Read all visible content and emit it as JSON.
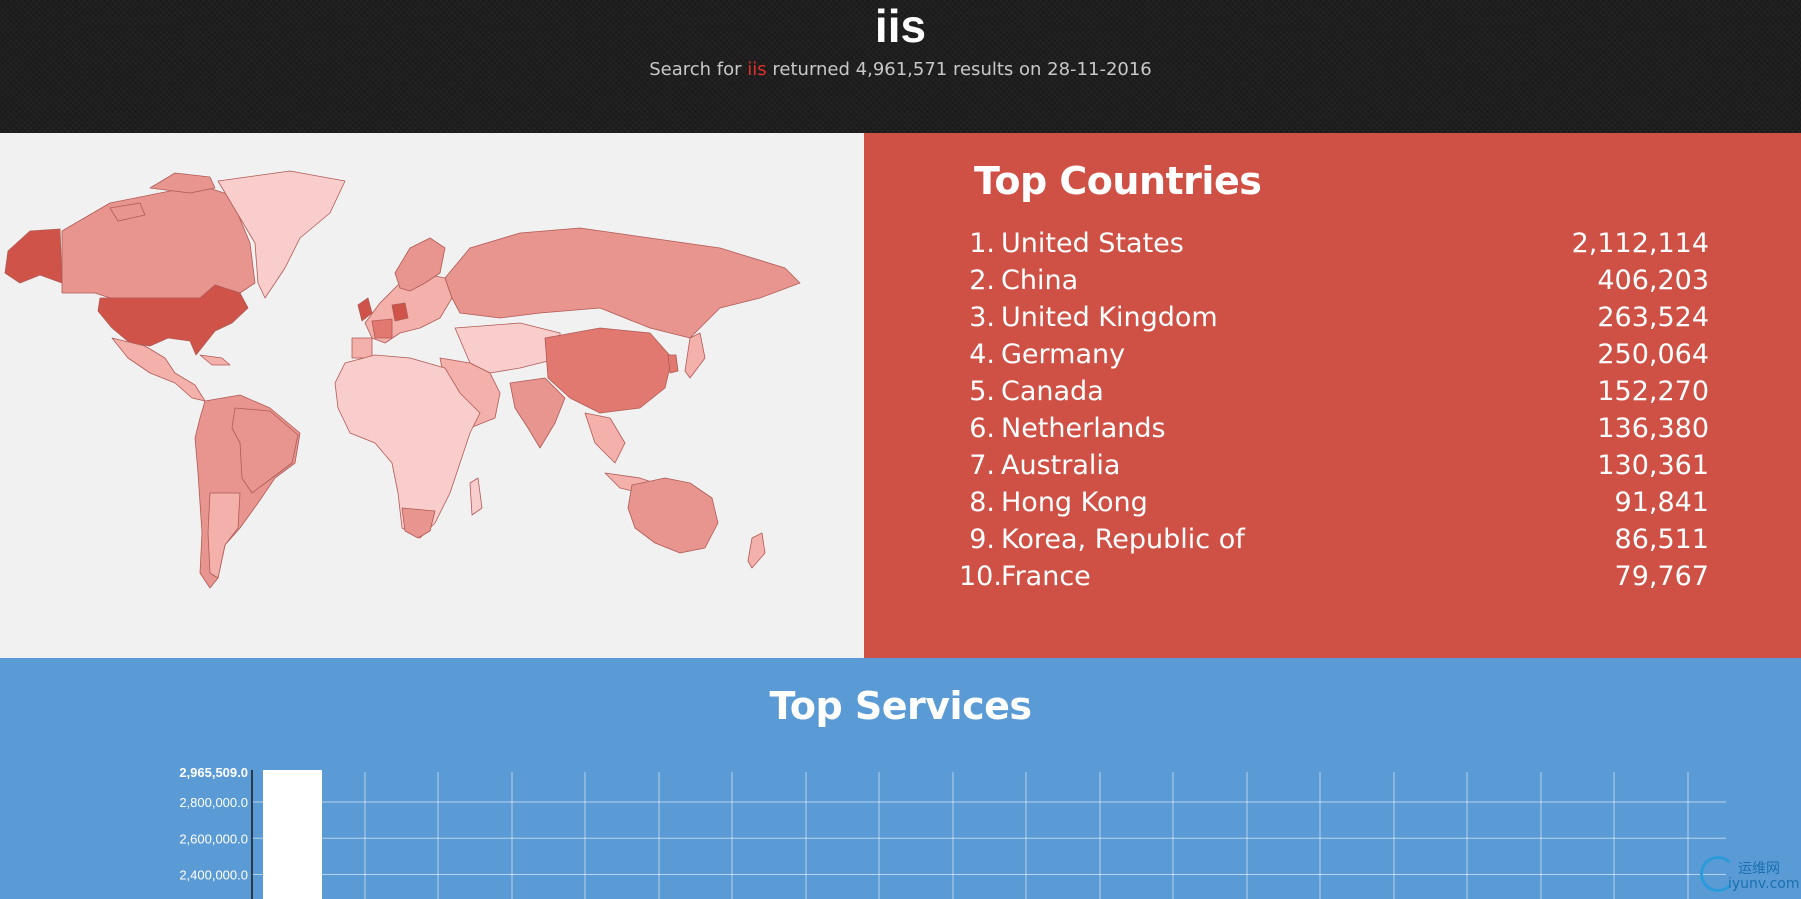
{
  "header": {
    "title": "iis",
    "subtitle_prefix": "Search for ",
    "query": "iis",
    "subtitle_suffix": " returned 4,961,571 results on 28-11-2016"
  },
  "colors": {
    "header_bg": "#1e1e1e",
    "map_bg": "#f1f1f1",
    "countries_bg": "#cf5146",
    "services_bg": "#5b9bd5",
    "query_highlight": "#e0302a"
  },
  "top_countries": {
    "title": "Top Countries",
    "items": [
      {
        "rank": "1.",
        "name": "United States",
        "count": "2,112,114"
      },
      {
        "rank": "2.",
        "name": "China",
        "count": "406,203"
      },
      {
        "rank": "3.",
        "name": "United Kingdom",
        "count": "263,524"
      },
      {
        "rank": "4.",
        "name": "Germany",
        "count": "250,064"
      },
      {
        "rank": "5.",
        "name": "Canada",
        "count": "152,270"
      },
      {
        "rank": "6.",
        "name": "Netherlands",
        "count": "136,380"
      },
      {
        "rank": "7.",
        "name": "Australia",
        "count": "130,361"
      },
      {
        "rank": "8.",
        "name": "Hong Kong",
        "count": "91,841"
      },
      {
        "rank": "9.",
        "name": "Korea, Republic of",
        "count": "86,511"
      },
      {
        "rank": "10.",
        "name": "France",
        "count": "79,767"
      }
    ]
  },
  "top_services": {
    "title": "Top Services"
  },
  "chart_data": {
    "type": "bar",
    "title": "Top Services",
    "ytick_labels": [
      "2,965,509.0",
      "2,800,000.0",
      "2,600,000.0",
      "2,400,000.0"
    ],
    "yticks": [
      2965509,
      2800000,
      2600000,
      2400000
    ],
    "ylim": [
      2200000,
      2965509
    ],
    "values": [
      2965509
    ],
    "grid": true
  },
  "watermark": {
    "cn": "运维网",
    "en": "iyunv.com",
    "icon": "swirl-logo-icon"
  }
}
